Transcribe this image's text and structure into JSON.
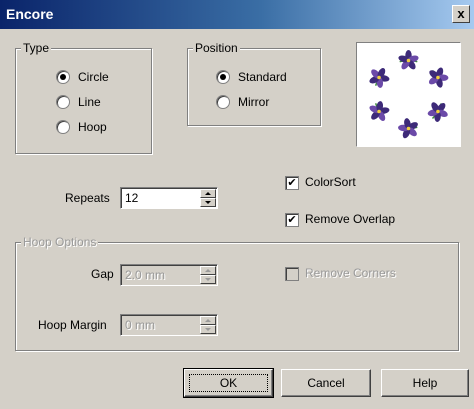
{
  "window": {
    "title": "Encore",
    "close_symbol": "x"
  },
  "type_group": {
    "title": "Type",
    "options": [
      {
        "label": "Circle",
        "selected": true
      },
      {
        "label": "Line",
        "selected": false
      },
      {
        "label": "Hoop",
        "selected": false
      }
    ]
  },
  "position_group": {
    "title": "Position",
    "options": [
      {
        "label": "Standard",
        "selected": true
      },
      {
        "label": "Mirror",
        "selected": false
      }
    ]
  },
  "repeats": {
    "label": "Repeats",
    "value": "12"
  },
  "checkboxes": {
    "colorsort": {
      "label": "ColorSort",
      "checked": true
    },
    "remove_overlap": {
      "label": "Remove Overlap",
      "checked": true
    }
  },
  "hoop_options": {
    "title": "Hoop Options",
    "gap": {
      "label": "Gap",
      "value": "2.0 mm"
    },
    "hoop_margin": {
      "label": "Hoop Margin",
      "value": "0 mm"
    },
    "remove_corners": {
      "label": "Remove Corners",
      "checked": false
    }
  },
  "buttons": {
    "ok": "OK",
    "cancel": "Cancel",
    "help": "Help"
  },
  "colors": {
    "petal": "#6b4aa8",
    "petal_dark": "#3d2a78",
    "leaf": "#3a8a3a",
    "center": "#f0d040"
  },
  "icons": {
    "check": "✔",
    "preview": "flower-wreath-preview"
  }
}
